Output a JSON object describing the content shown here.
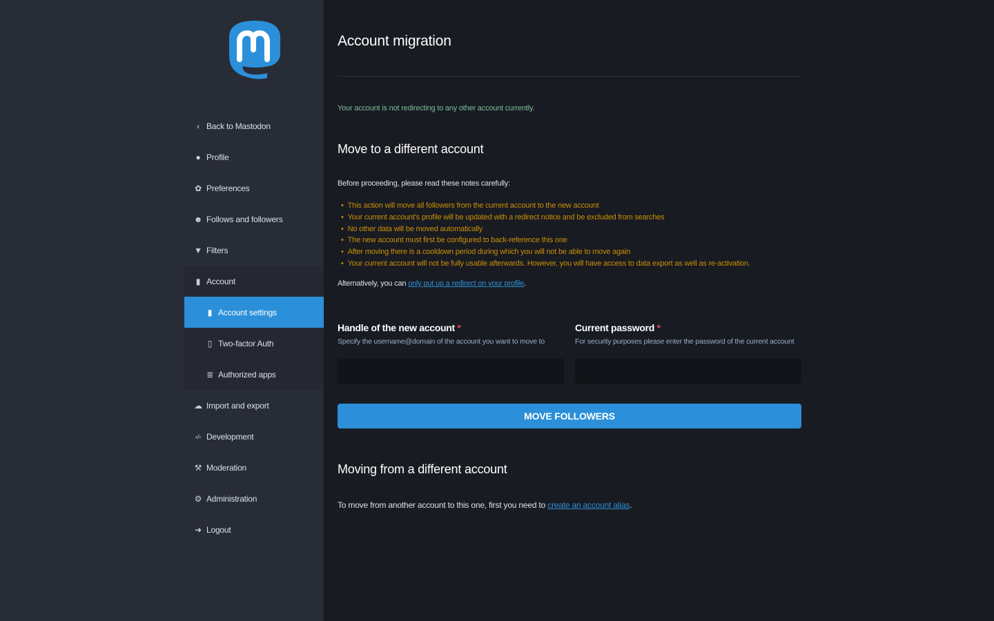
{
  "sidebar": {
    "items": [
      {
        "icon": "chevron-left-icon",
        "glyph": "‹",
        "label": "Back to Mastodon"
      },
      {
        "icon": "user-icon",
        "glyph": "●",
        "label": "Profile"
      },
      {
        "icon": "gear-icon",
        "glyph": "✿",
        "label": "Preferences"
      },
      {
        "icon": "users-icon",
        "glyph": "☻",
        "label": "Follows and followers"
      },
      {
        "icon": "filter-icon",
        "glyph": "▼",
        "label": "Filters"
      },
      {
        "icon": "lock-icon",
        "glyph": "▮",
        "label": "Account"
      }
    ],
    "subitems": [
      {
        "icon": "lock-icon",
        "glyph": "▮",
        "label": "Account settings",
        "active": true
      },
      {
        "icon": "mobile-icon",
        "glyph": "▯",
        "label": "Two-factor Auth"
      },
      {
        "icon": "list-icon",
        "glyph": "≣",
        "label": "Authorized apps"
      }
    ],
    "bottom_items": [
      {
        "icon": "cloud-icon",
        "glyph": "☁",
        "label": "Import and export"
      },
      {
        "icon": "code-icon",
        "glyph": "‹/›",
        "label": "Development"
      },
      {
        "icon": "gavel-icon",
        "glyph": "⚒",
        "label": "Moderation"
      },
      {
        "icon": "cogs-icon",
        "glyph": "⚙",
        "label": "Administration"
      },
      {
        "icon": "sign-out-icon",
        "glyph": "➜",
        "label": "Logout"
      }
    ]
  },
  "main": {
    "title": "Account migration",
    "status": "Your account is not redirecting to any other account currently.",
    "move_section": {
      "heading": "Move to a different account",
      "intro": "Before proceeding, please read these notes carefully:",
      "warnings": [
        "This action will move all followers from the current account to the new account",
        "Your current account's profile will be updated with a redirect notice and be excluded from searches",
        "No other data will be moved automatically",
        "The new account must first be configured to back-reference this one",
        "After moving there is a cooldown period during which you will not be able to move again",
        "Your current account will not be fully usable afterwards. However, you will have access to data export as well as re-activation."
      ],
      "alt_prefix": "Alternatively, you can ",
      "alt_link": "only put up a redirect on your profile",
      "alt_suffix": ".",
      "handle_label": "Handle of the new account",
      "handle_hint": "Specify the username@domain of the account you want to move to",
      "password_label": "Current password",
      "password_hint": "For security purposes please enter the password of the current account",
      "required_mark": "*",
      "button": "MOVE FOLLOWERS"
    },
    "from_section": {
      "heading": "Moving from a different account",
      "text_prefix": "To move from another account to this one, first you need to ",
      "link": "create an account alias",
      "text_suffix": "."
    }
  },
  "colors": {
    "accent": "#2b90d9",
    "success": "#79bd9a",
    "warning": "#ca8f04",
    "required": "#df405a"
  }
}
